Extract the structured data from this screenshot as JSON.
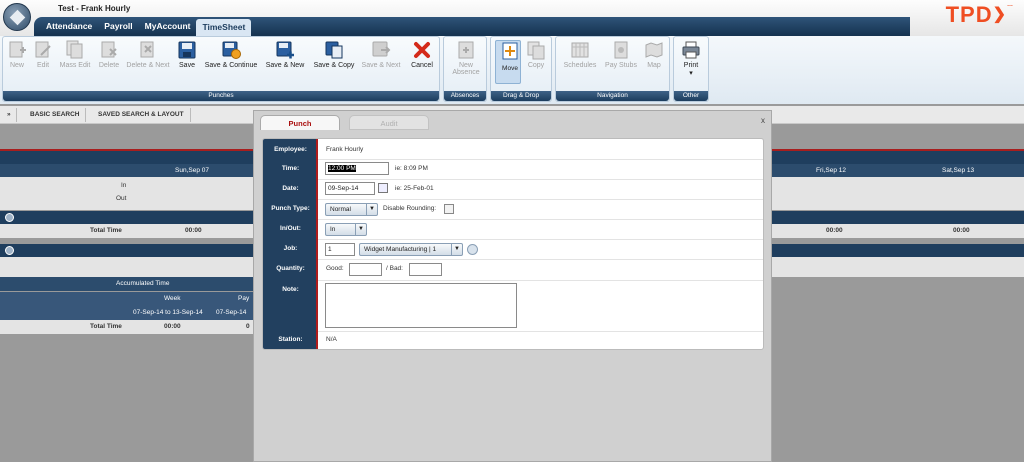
{
  "window": {
    "title": "Test - Frank Hourly"
  },
  "brand": {
    "name": "TPD",
    "chevron": "❯",
    "dot": "…"
  },
  "nav": {
    "tabs": [
      {
        "label": "Attendance"
      },
      {
        "label": "Payroll"
      },
      {
        "label": "MyAccount"
      },
      {
        "label": "TimeSheet",
        "active": true
      }
    ]
  },
  "ribbon": {
    "groups": {
      "punches": "Punches",
      "absences": "Absences",
      "dragdrop": "Drag & Drop",
      "navigation": "Navigation",
      "other": "Other"
    },
    "punches": [
      {
        "label": "New",
        "enabled": false
      },
      {
        "label": "Edit",
        "enabled": false
      },
      {
        "label": "Mass Edit",
        "enabled": false
      },
      {
        "label": "Delete",
        "enabled": false
      },
      {
        "label": "Delete & Next",
        "enabled": false
      },
      {
        "label": "Save",
        "enabled": true
      },
      {
        "label": "Save & Continue",
        "enabled": true
      },
      {
        "label": "Save & New",
        "enabled": true
      },
      {
        "label": "Save & Copy",
        "enabled": true
      },
      {
        "label": "Save & Next",
        "enabled": false
      },
      {
        "label": "Cancel",
        "enabled": true
      }
    ],
    "absences": {
      "label1": "New",
      "label2": "Absence"
    },
    "dragdrop": {
      "move": "Move",
      "copy": "Copy"
    },
    "navigation": {
      "schedules": "Schedules",
      "paystubs": "Pay Stubs",
      "map": "Map"
    },
    "other": {
      "print": "Print",
      "print_arrow": "▾"
    }
  },
  "search": {
    "toggle": "»",
    "basic": "BASIC SEARCH",
    "saved": "SAVED SEARCH & LAYOUT"
  },
  "grid": {
    "days": [
      "Sun,Sep 07",
      "Fri,Sep 12",
      "Sat,Sep 13"
    ],
    "in": "In",
    "out": "Out",
    "section_icon": "8",
    "total_time": "Total Time",
    "total_value": "00:00",
    "accumulated": {
      "title": "Accumulated Time",
      "week": "Week",
      "pay": "Pay",
      "range": "07-Sep-14 to 13-Sep-14",
      "range2": "07-Sep-14",
      "total_label": "Total Time",
      "total_value": "00:00",
      "total_value2": "0"
    }
  },
  "modal": {
    "tabs": {
      "punch": "Punch",
      "audit": "Audit"
    },
    "close": "x",
    "labels": {
      "employee": "Employee:",
      "time": "Time:",
      "date": "Date:",
      "punch_type": "Punch Type:",
      "in_out": "In/Out:",
      "job": "Job:",
      "quantity": "Quantity:",
      "note": "Note:",
      "station": "Station:"
    },
    "values": {
      "employee": "Frank Hourly",
      "time": "12:00 PM",
      "time_hint": "ie: 8:09 PM",
      "date": "09-Sep-14",
      "date_hint": "ie: 25-Feb-01",
      "punch_type": "Normal",
      "disable_rounding": "Disable Rounding:",
      "in_out": "In",
      "job_qty": "1",
      "job": "Widget Manufacturing | 1",
      "good": "Good:",
      "bad": "/ Bad:",
      "note": "",
      "station": "N/A"
    }
  },
  "colors": {
    "navy": "#1f3e5e",
    "accent": "#b01c1c",
    "brand": "#ef4e23"
  }
}
